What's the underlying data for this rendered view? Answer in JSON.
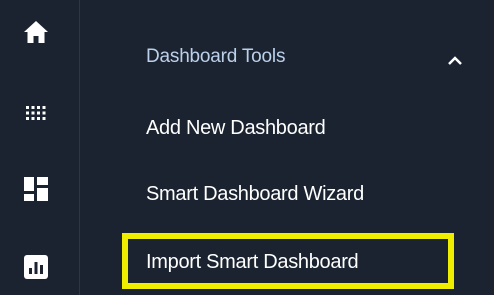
{
  "rail": {
    "icons": [
      {
        "name": "home-icon"
      },
      {
        "name": "apps-grid-icon"
      },
      {
        "name": "dashboard-icon"
      },
      {
        "name": "chart-icon"
      }
    ]
  },
  "menu": {
    "header": {
      "label": "Dashboard Tools",
      "expanded": true
    },
    "items": [
      {
        "label": "Add New Dashboard"
      },
      {
        "label": "Smart Dashboard Wizard"
      },
      {
        "label": "Import Smart Dashboard",
        "highlighted": true
      }
    ]
  },
  "colors": {
    "background": "#1b2330",
    "header_text": "#bcd0ea",
    "item_text": "#ffffff",
    "highlight_border": "#f0ee00"
  }
}
